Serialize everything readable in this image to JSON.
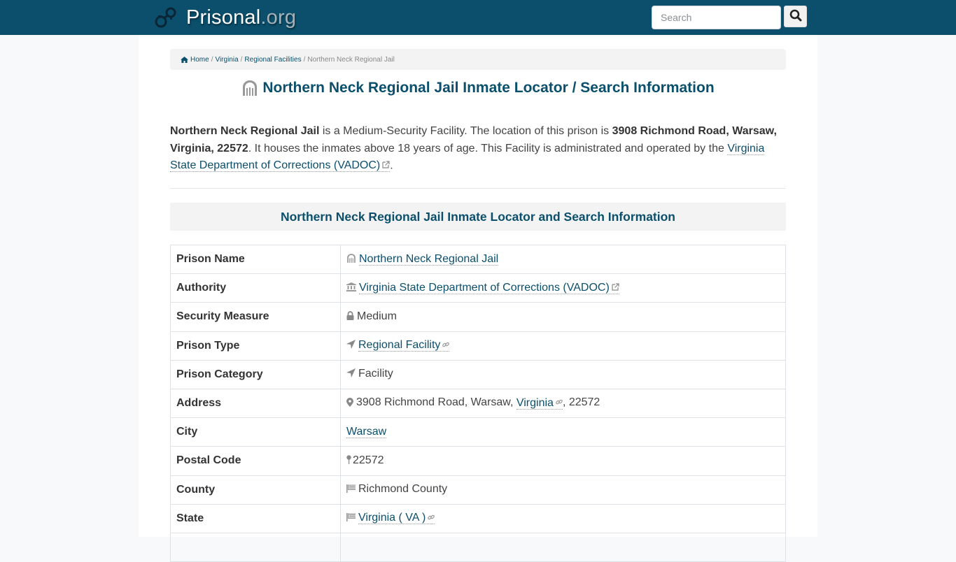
{
  "header": {
    "brand_main": "Prisonal",
    "brand_tld": ".org",
    "brand_icon": "handcuffs-icon",
    "search_placeholder": "Search",
    "search_value": "",
    "search_button_icon": "search-icon"
  },
  "breadcrumb": {
    "items": [
      {
        "label": "Home",
        "icon": "home-icon",
        "link": true
      },
      {
        "label": "Virginia",
        "link": true
      },
      {
        "label": "Regional Facilities",
        "link": true
      },
      {
        "label": "Northern Neck Regional Jail",
        "link": false
      }
    ],
    "separator": "/"
  },
  "page_title": {
    "icon": "prison-gate-icon",
    "text": "Northern Neck Regional Jail Inmate Locator / Search Information"
  },
  "intro": {
    "facility_name": "Northern Neck Regional Jail",
    "text_1": " is a Medium-Security Facility. The location of this prison is ",
    "address_bold": "3908 Richmond Road, Warsaw, Virginia, 22572",
    "text_2": ". It houses the inmates above 18 years of age. This Facility is administrated and operated by the ",
    "authority_link": "Virginia State Department of Corrections (VADOC)",
    "text_3": "."
  },
  "section_heading": "Northern Neck Regional Jail Inmate Locator and Search Information",
  "table": {
    "rows": [
      {
        "label": "Prison Name",
        "icon": "prison-gate-icon",
        "value": "Northern Neck Regional Jail",
        "link": true,
        "suffix_icon": null
      },
      {
        "label": "Authority",
        "icon": "government-building-icon",
        "value": "Virginia State Department of Corrections (VADOC)",
        "link": true,
        "suffix_icon": "external-link-icon"
      },
      {
        "label": "Security Measure",
        "icon": "lock-icon",
        "value": "Medium",
        "link": false,
        "suffix_icon": null
      },
      {
        "label": "Prison Type",
        "icon": "location-arrow-icon",
        "value": "Regional Facility",
        "link": true,
        "suffix_icon": "chain-link-icon"
      },
      {
        "label": "Prison Category",
        "icon": "location-arrow-icon",
        "value": "Facility",
        "link": false,
        "suffix_icon": null
      },
      {
        "label": "Address",
        "icon": "map-marker-icon",
        "value_prefix": "3908 Richmond Road, Warsaw, ",
        "value_link": "Virginia",
        "value_suffix": ", 22572",
        "suffix_icon": "chain-link-icon"
      },
      {
        "label": "City",
        "icon": null,
        "value": "Warsaw",
        "link": true,
        "suffix_icon": null
      },
      {
        "label": "Postal Code",
        "icon": "map-pin-icon",
        "value": "22572",
        "link": false,
        "suffix_icon": null
      },
      {
        "label": "County",
        "icon": "flag-icon",
        "value": "Richmond County",
        "link": false,
        "suffix_icon": null
      },
      {
        "label": "State",
        "icon": "flag-icon",
        "value": "Virginia ( VA )",
        "link": true,
        "suffix_icon": "chain-link-icon"
      }
    ]
  },
  "colors": {
    "header_bg": "#0b4f6c",
    "link": "#0b4f6c",
    "page_bg": "#f8f9fa",
    "panel_bg": "#f3f3f3"
  }
}
